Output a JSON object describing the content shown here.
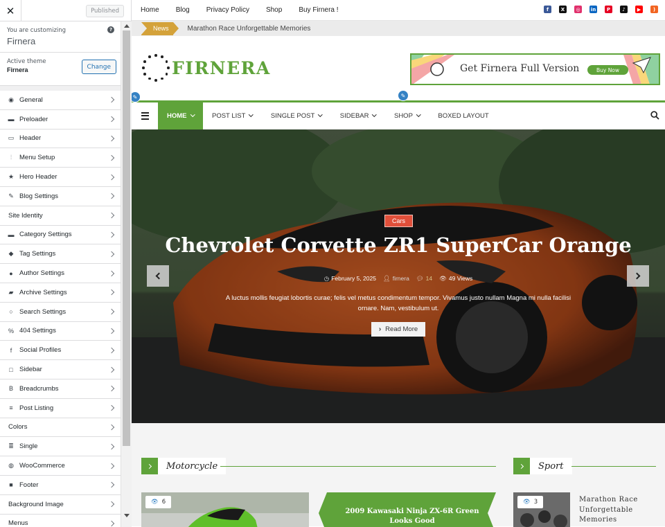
{
  "customizer": {
    "close_icon": "close-icon",
    "published_label": "Published",
    "customizing_label": "You are customizing",
    "site_name": "Firnera",
    "active_theme_label": "Active theme",
    "active_theme_name": "Firnera",
    "change_label": "Change",
    "sections": [
      {
        "label": "General",
        "icon": "globe-icon"
      },
      {
        "label": "Preloader",
        "icon": "folder-icon"
      },
      {
        "label": "Header",
        "icon": "laptop-icon"
      },
      {
        "label": "Menu Setup",
        "icon": "sliders-icon"
      },
      {
        "label": "Hero Header",
        "icon": "star-icon"
      },
      {
        "label": "Blog Settings",
        "icon": "pencil-icon"
      },
      {
        "label": "Site Identity",
        "icon": ""
      },
      {
        "label": "Category Settings",
        "icon": "folder-icon"
      },
      {
        "label": "Tag Settings",
        "icon": "tag-icon"
      },
      {
        "label": "Author Settings",
        "icon": "user-icon"
      },
      {
        "label": "Archive Settings",
        "icon": "folder-open-icon"
      },
      {
        "label": "Search Settings",
        "icon": "search-icon"
      },
      {
        "label": "404 Settings",
        "icon": "percent-icon"
      },
      {
        "label": "Social Profiles",
        "icon": "facebook-icon"
      },
      {
        "label": "Sidebar",
        "icon": "square-icon"
      },
      {
        "label": "Breadcrumbs",
        "icon": "bold-b-icon"
      },
      {
        "label": "Post Listing",
        "icon": "list-icon"
      },
      {
        "label": "Colors",
        "icon": ""
      },
      {
        "label": "Single",
        "icon": "document-icon"
      },
      {
        "label": "WooCommerce",
        "icon": "woo-icon"
      },
      {
        "label": "Footer",
        "icon": "square-filled-icon"
      },
      {
        "label": "Background Image",
        "icon": ""
      },
      {
        "label": "Menus",
        "icon": ""
      }
    ]
  },
  "site": {
    "top_links": [
      "Home",
      "Blog",
      "Privacy Policy",
      "Shop",
      "Buy Firnera !"
    ],
    "socials": [
      {
        "name": "facebook-icon",
        "color": "#3b5998",
        "glyph": "f"
      },
      {
        "name": "x-icon",
        "color": "#111111",
        "glyph": "X"
      },
      {
        "name": "instagram-icon",
        "color": "#e1306c",
        "glyph": "◎"
      },
      {
        "name": "linkedin-icon",
        "color": "#0a66c2",
        "glyph": "in"
      },
      {
        "name": "pinterest-icon",
        "color": "#e60023",
        "glyph": "P"
      },
      {
        "name": "tiktok-icon",
        "color": "#111111",
        "glyph": "♪"
      },
      {
        "name": "youtube-icon",
        "color": "#ff0000",
        "glyph": "▶"
      },
      {
        "name": "rss-icon",
        "color": "#f26522",
        "glyph": ")"
      }
    ],
    "news_label": "News",
    "news_ticker": "Marathon Race Unforgettable Memories",
    "logo_text": "FIRNERA",
    "promo_text": "Get Firnera Full Version",
    "promo_button": "Buy Now",
    "accent_color": "#5fa33a",
    "nav": [
      {
        "label": "HOME",
        "dropdown": true,
        "active": true
      },
      {
        "label": "POST LIST",
        "dropdown": true,
        "active": false
      },
      {
        "label": "SINGLE POST",
        "dropdown": true,
        "active": false
      },
      {
        "label": "SIDEBAR",
        "dropdown": true,
        "active": false
      },
      {
        "label": "SHOP",
        "dropdown": true,
        "active": false
      },
      {
        "label": "BOXED LAYOUT",
        "dropdown": false,
        "active": false
      }
    ],
    "hero": {
      "category": "Cars",
      "title": "Chevrolet Corvette ZR1 SuperCar Orange",
      "date": "February 5, 2025",
      "author": "firnera",
      "comments": "14",
      "views": "49 Views",
      "excerpt": "A luctus mollis feugiat lobortis curae; felis vel metus condimentum tempor. Vivamus justo nullam Magna mi nulla facilisi ornare. Nam, vestibulum ut.",
      "read_more": "Read More"
    },
    "sections": {
      "left_title": "Motorcycle",
      "right_title": "Sport",
      "card1_views": "6",
      "card2_title": "2009 Kawasaki Ninja ZX-6R Green Looks Good",
      "card3_views": "3",
      "card3_title": "Marathon Race Unforgettable Memories"
    }
  }
}
